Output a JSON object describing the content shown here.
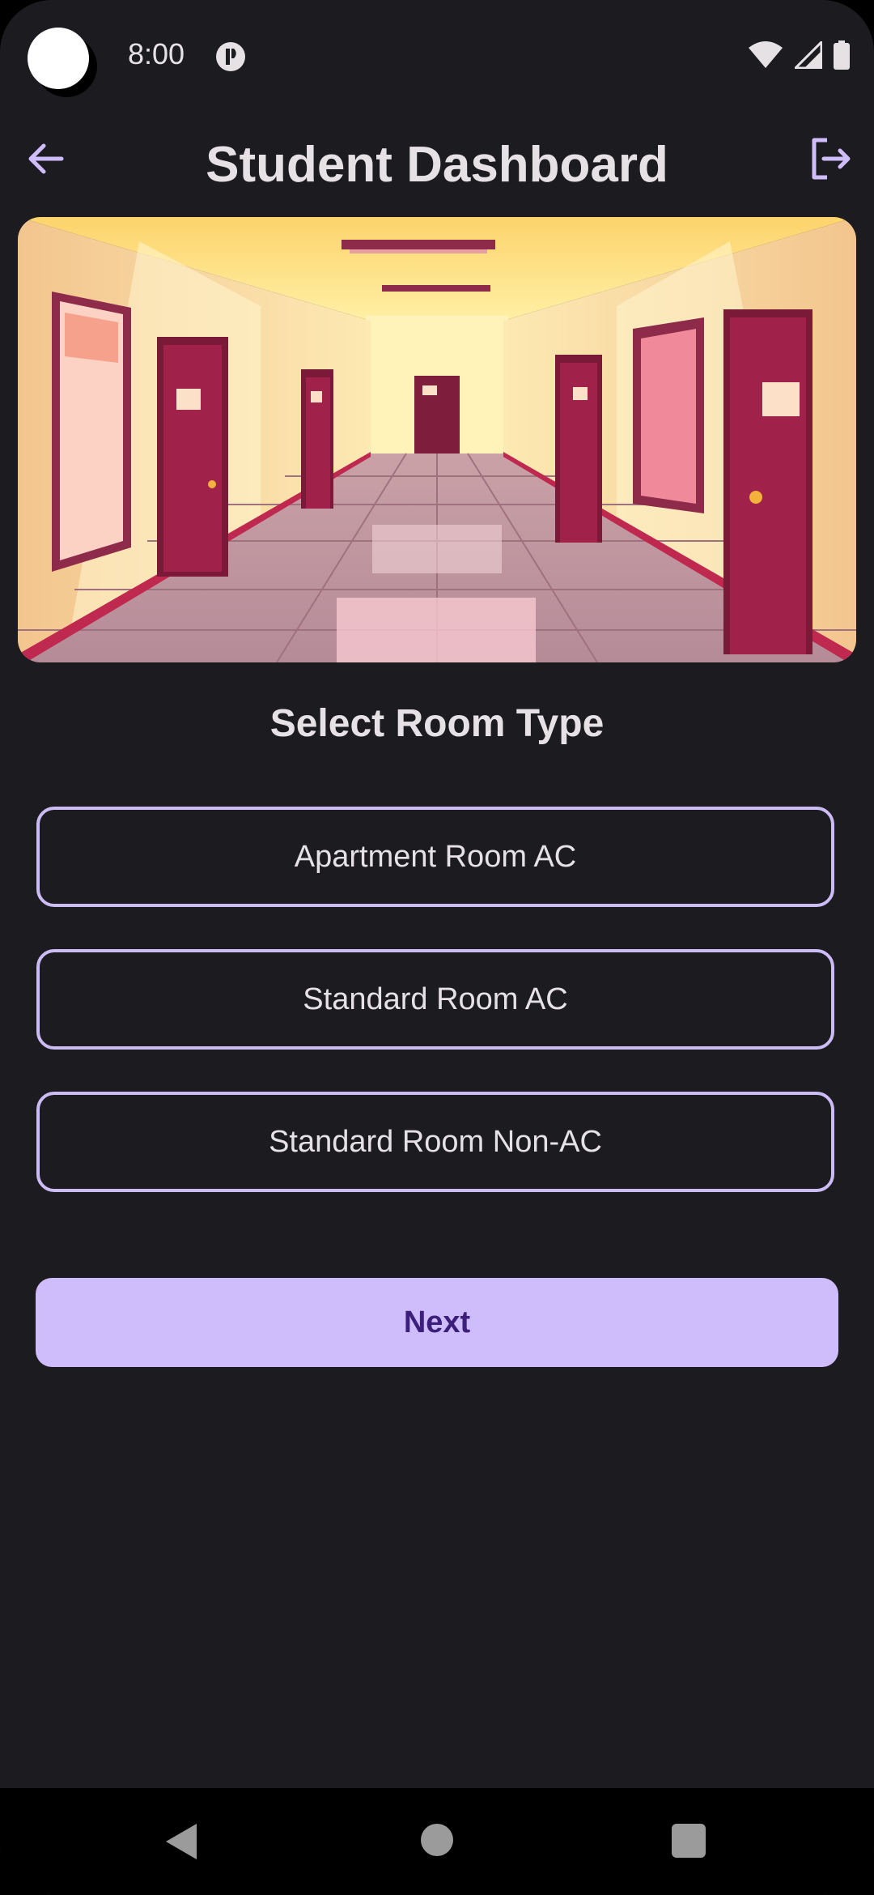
{
  "status_bar": {
    "time": "8:00",
    "icons": [
      "notification-icon",
      "wifi-icon",
      "signal-icon",
      "battery-icon"
    ]
  },
  "app_bar": {
    "title": "Student Dashboard",
    "back_icon": "arrow-back-icon",
    "logout_icon": "logout-icon"
  },
  "hero": {
    "image": "hallway-illustration"
  },
  "room_selection": {
    "heading": "Select Room Type",
    "options": [
      {
        "label": "Apartment Room AC"
      },
      {
        "label": "Standard Room AC"
      },
      {
        "label": "Standard Room Non-AC"
      }
    ]
  },
  "actions": {
    "next_label": "Next"
  },
  "colors": {
    "background": "#1c1b1f",
    "accent": "#cfbcfa",
    "outline": "#cbbcf4",
    "on_accent": "#3b1f7a",
    "text": "#e6e1e5"
  },
  "navigation": {
    "icons": [
      "nav-back-icon",
      "nav-home-icon",
      "nav-recents-icon"
    ]
  }
}
